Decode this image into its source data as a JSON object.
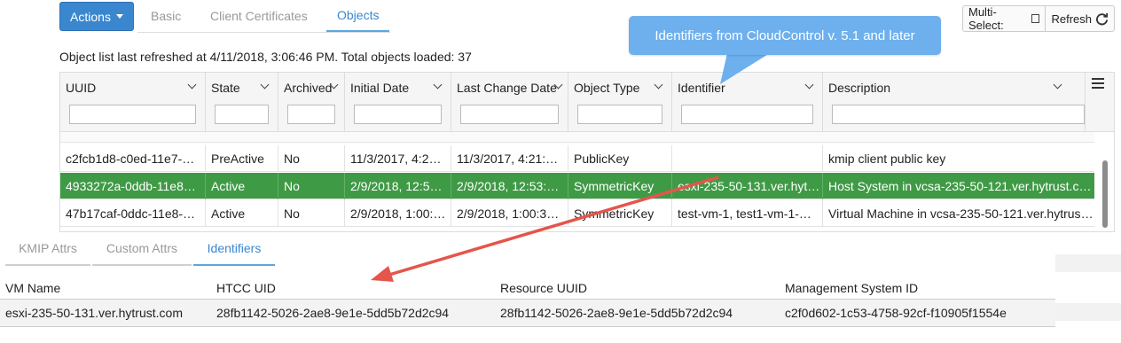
{
  "toolbar": {
    "actions_label": "Actions",
    "tabs": [
      {
        "label": "Basic"
      },
      {
        "label": "Client Certificates"
      },
      {
        "label": "Objects"
      }
    ],
    "multi_select_label": "Multi-Select:",
    "refresh_label": "Refresh"
  },
  "status_line": "Object list last refreshed at 4/11/2018, 3:06:46 PM. Total objects loaded: 37",
  "callout": {
    "text": "Identifiers from CloudControl v. 5.1 and later",
    "color": "#6eb0ee",
    "arrow_color": "#e4554b"
  },
  "grid": {
    "columns": [
      {
        "label": "UUID"
      },
      {
        "label": "State"
      },
      {
        "label": "Archived"
      },
      {
        "label": "Initial Date"
      },
      {
        "label": "Last Change Date"
      },
      {
        "label": "Object Type"
      },
      {
        "label": "Identifier"
      },
      {
        "label": "Description"
      }
    ],
    "rows": [
      {
        "uuid": "c2fcb1d8-c0ed-11e7-…",
        "state": "PreActive",
        "archived": "No",
        "initial": "11/3/2017, 4:2…",
        "last": "11/3/2017, 4:21:…",
        "type": "PublicKey",
        "identifier": "",
        "description": "kmip client public key",
        "selected": false
      },
      {
        "uuid": "4933272a-0ddb-11e8…",
        "state": "Active",
        "archived": "No",
        "initial": "2/9/2018, 12:5…",
        "last": "2/9/2018, 12:53:…",
        "type": "SymmetricKey",
        "identifier": "esxi-235-50-131.ver.hyt…",
        "description": "Host System in vcsa-235-50-121.ver.hytrust.c…",
        "selected": true
      },
      {
        "uuid": "47b17caf-0ddc-11e8-…",
        "state": "Active",
        "archived": "No",
        "initial": "2/9/2018, 1:00:…",
        "last": "2/9/2018, 1:00:3…",
        "type": "SymmetricKey",
        "identifier": "test-vm-1, test1-vm-1-…",
        "description": "Virtual Machine in vcsa-235-50-121.ver.hytrust…",
        "selected": false
      }
    ],
    "selected_color": "#3f9a45"
  },
  "detail": {
    "tabs": [
      {
        "label": "KMIP Attrs"
      },
      {
        "label": "Custom Attrs"
      },
      {
        "label": "Identifiers"
      }
    ],
    "headers": [
      "VM Name",
      "HTCC UID",
      "Resource UUID",
      "Management System ID"
    ],
    "row": [
      "esxi-235-50-131.ver.hytrust.com",
      "28fb1142-5026-2ae8-9e1e-5dd5b72d2c94",
      "28fb1142-5026-2ae8-9e1e-5dd5b72d2c94",
      "c2f0d602-1c53-4758-92cf-f10905f1554e"
    ]
  },
  "accent_color": "#3a87cf"
}
